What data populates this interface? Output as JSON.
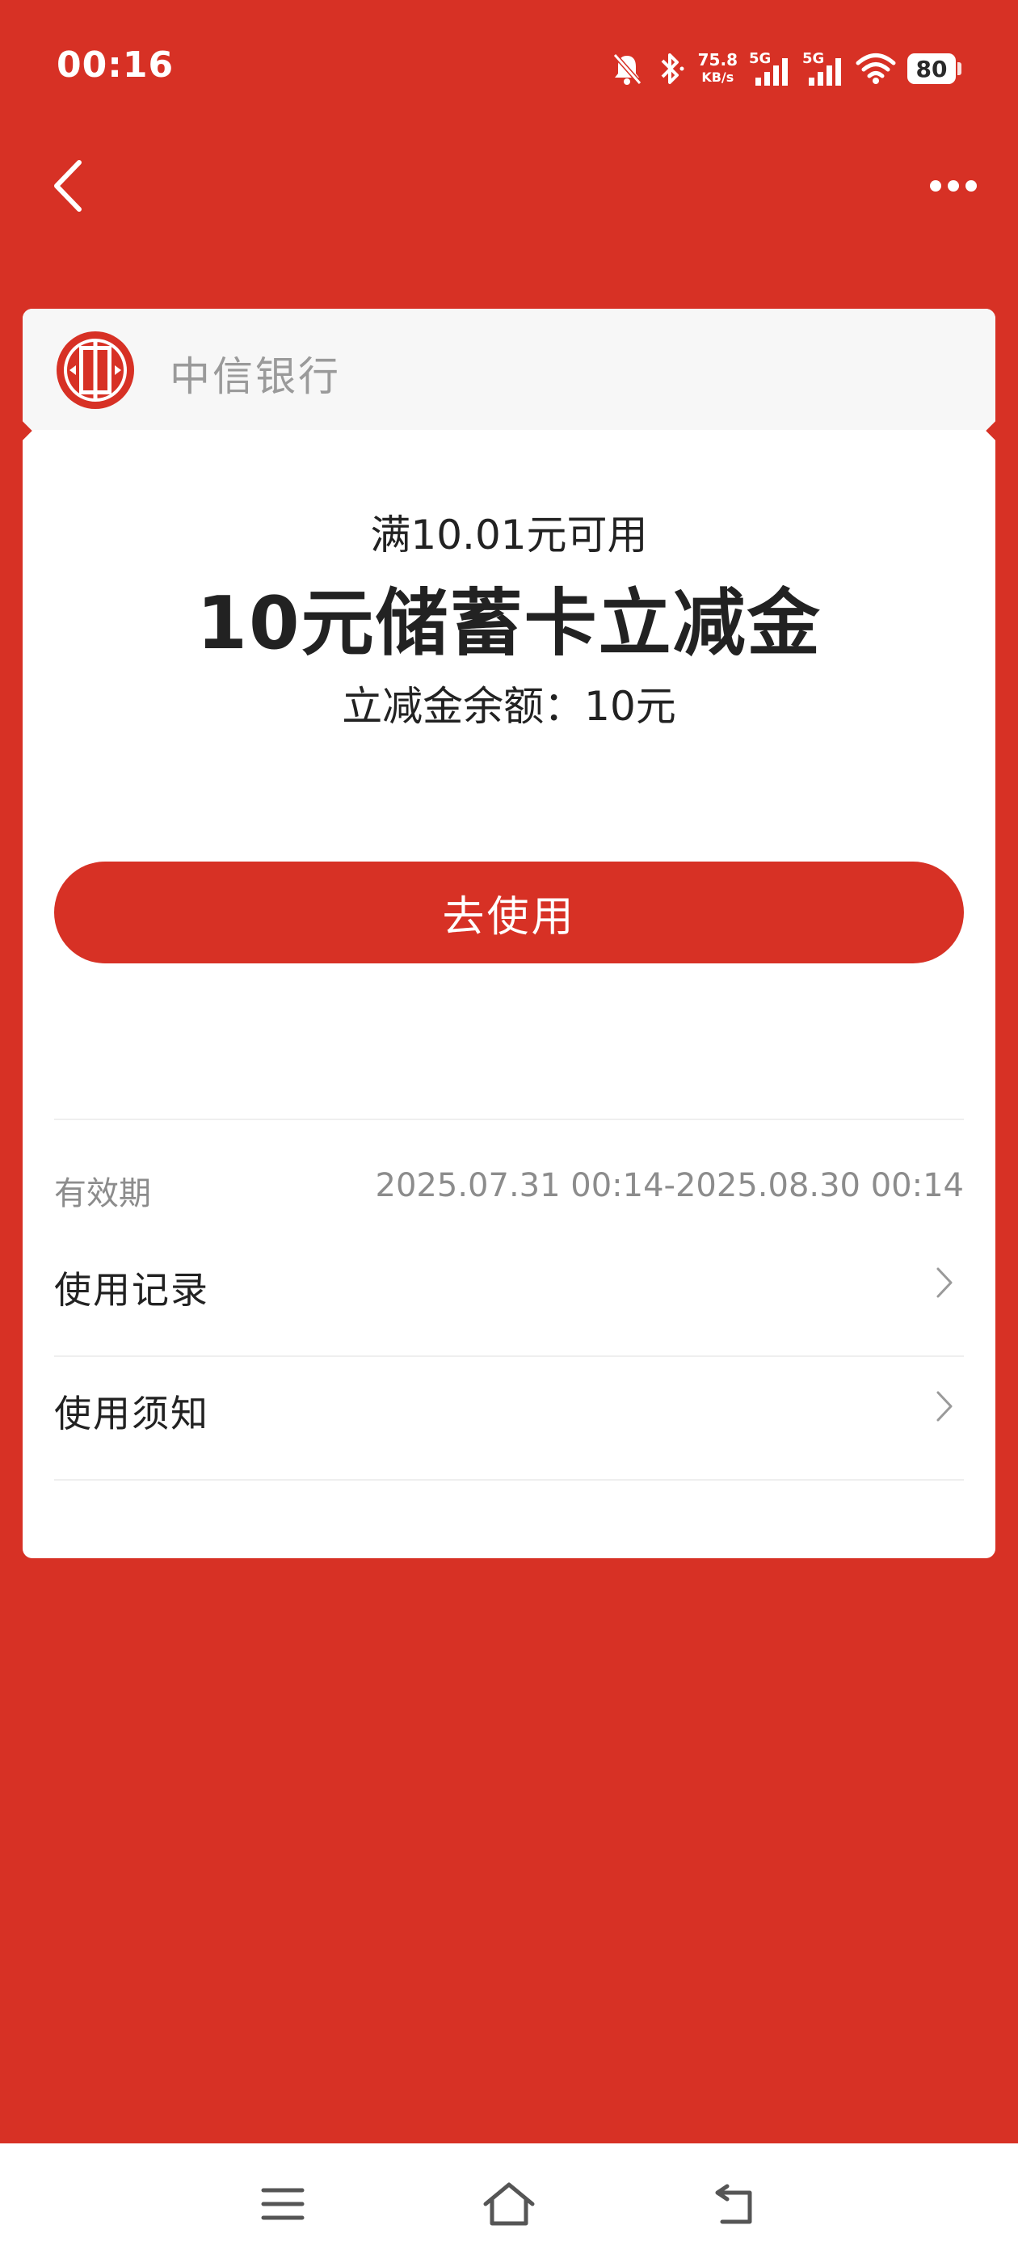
{
  "status_bar": {
    "time": "00:16",
    "net_speed_value": "75.8",
    "net_speed_unit": "KB/s",
    "signal1_label": "5G",
    "signal2_label": "5G",
    "battery_level": "80"
  },
  "nav": {
    "back_icon": "chevron-left-icon",
    "more_icon": "more-dots-icon"
  },
  "card": {
    "bank_name": "中信银行",
    "condition": "满10.01元可用",
    "title": "10元储蓄卡立减金",
    "balance": "立减金余额：10元",
    "use_button_label": "去使用",
    "validity_label": "有效期",
    "validity_value": "2025.07.31 00:14-2025.08.30 00:14",
    "rows": [
      {
        "label": "使用记录"
      },
      {
        "label": "使用须知"
      }
    ]
  },
  "colors": {
    "brand_red": "#D73125",
    "card_bg": "#FFFFFF",
    "header_bg": "#F7F7F7"
  }
}
